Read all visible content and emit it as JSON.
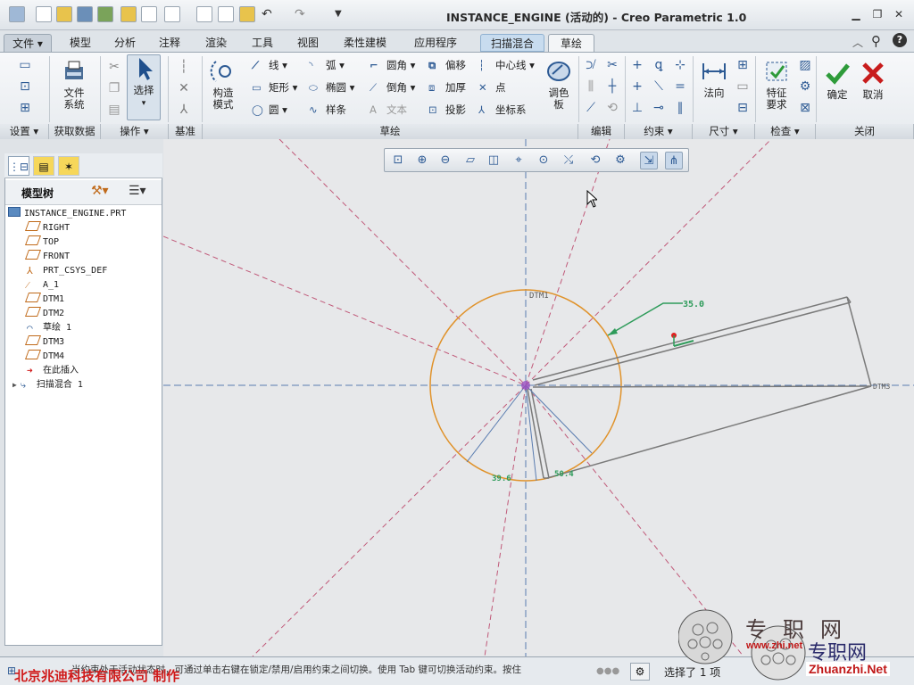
{
  "window": {
    "title": "INSTANCE_ENGINE (活动的) - Creo Parametric 1.0",
    "controls": [
      "minimize",
      "restore",
      "close"
    ]
  },
  "menu": {
    "tabs": [
      {
        "label": "文件",
        "active": false
      },
      {
        "label": "模型",
        "active": false
      },
      {
        "label": "分析",
        "active": false
      },
      {
        "label": "注释",
        "active": false
      },
      {
        "label": "渲染",
        "active": false
      },
      {
        "label": "工具",
        "active": false
      },
      {
        "label": "视图",
        "active": false
      },
      {
        "label": "柔性建模",
        "active": false
      },
      {
        "label": "应用程序",
        "active": false
      },
      {
        "label": "扫描混合",
        "active": false
      },
      {
        "label": "草绘",
        "active": true
      }
    ]
  },
  "ribbon": {
    "file_system": "文件\n系统",
    "select": "选择",
    "construct_mode": "构造\n模式",
    "line": "线",
    "arc": "弧",
    "fillet": "圆角",
    "offset": "偏移",
    "centerline": "中心线",
    "rectangle": "矩形",
    "ellipse": "椭圆",
    "chamfer": "倒角",
    "thicken": "加厚",
    "point": "点",
    "circle": "圆",
    "spline": "样条",
    "text": "文本",
    "project": "投影",
    "coord_sys": "坐标系",
    "palette": "调色\n板",
    "normal": "法向",
    "feature_req": "特征\n要求",
    "ok": "确定",
    "cancel": "取消",
    "groups": [
      {
        "label": "设置",
        "dropdown": true
      },
      {
        "label": "获取数据",
        "dropdown": false
      },
      {
        "label": "操作",
        "dropdown": true
      },
      {
        "label": "基准",
        "dropdown": false
      },
      {
        "label": "草绘",
        "dropdown": false
      },
      {
        "label": "编辑",
        "dropdown": false
      },
      {
        "label": "约束",
        "dropdown": true
      },
      {
        "label": "尺寸",
        "dropdown": true
      },
      {
        "label": "检查",
        "dropdown": true
      },
      {
        "label": "关闭",
        "dropdown": false
      }
    ]
  },
  "tree": {
    "title": "模型树",
    "items": [
      {
        "label": "INSTANCE_ENGINE.PRT",
        "icon": "part-icon"
      },
      {
        "label": "RIGHT",
        "icon": "datum-plane-icon"
      },
      {
        "label": "TOP",
        "icon": "datum-plane-icon"
      },
      {
        "label": "FRONT",
        "icon": "datum-plane-icon"
      },
      {
        "label": "PRT_CSYS_DEF",
        "icon": "csys-icon"
      },
      {
        "label": "A_1",
        "icon": "axis-icon"
      },
      {
        "label": "DTM1",
        "icon": "datum-plane-icon"
      },
      {
        "label": "DTM2",
        "icon": "datum-plane-icon"
      },
      {
        "label": "草绘 1",
        "icon": "sketch-icon"
      },
      {
        "label": "DTM3",
        "icon": "datum-plane-icon"
      },
      {
        "label": "DTM4",
        "icon": "datum-plane-icon"
      },
      {
        "label": "在此插入",
        "icon": "insert-here-icon"
      },
      {
        "label": "扫描混合 1",
        "icon": "sweep-blend-icon"
      }
    ]
  },
  "sketch": {
    "labels": {
      "dim1": "35.0",
      "dim2": "39.6",
      "dim3": "50.4",
      "dtm1": "DTM1",
      "dtm3": "DTM3"
    }
  },
  "status": {
    "company": "北京兆迪科技有限公司   制作",
    "message": "当约束处于活动状态时，可通过单击右键在锁定/禁用/启用约束之间切换。使用 Tab 键可切换活动约束。按住",
    "selected": "选择了 1 项"
  },
  "watermark": {
    "cn": "专职网",
    "cn2": "专职网",
    "url": "Zhuanzhi.Net",
    "partial": "www.zhi.net"
  },
  "colors": {
    "circle": "#e0922a",
    "datum": "#c05878",
    "axis_blue": "#5a7cb0",
    "dim_green": "#2e9b5a",
    "geometry": "#7a7a7a",
    "company_red": "#d01a1a"
  }
}
